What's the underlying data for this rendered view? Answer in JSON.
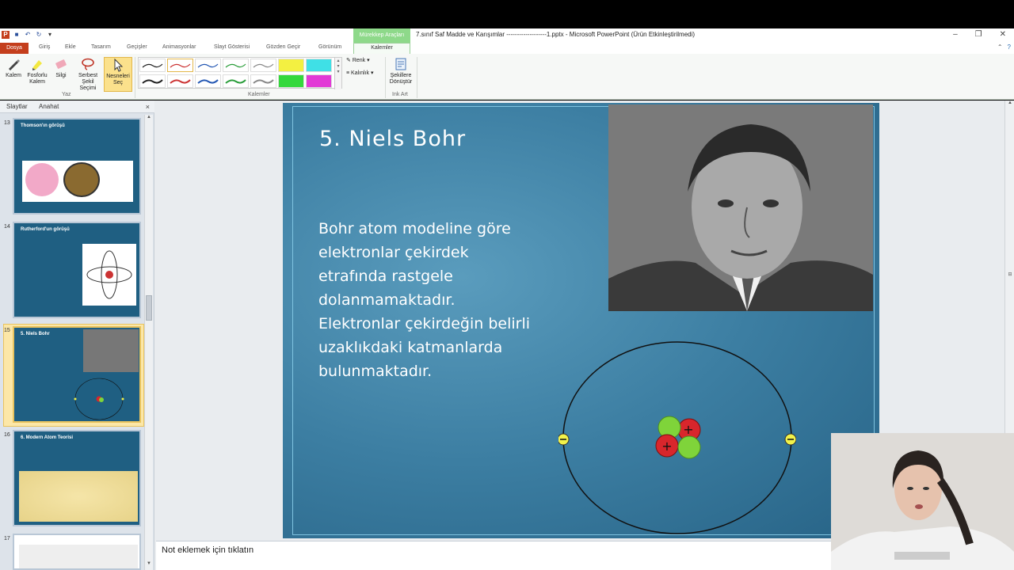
{
  "window": {
    "title": "7.sınıf Saf Madde ve Karışımlar -------------------1.pptx  -  Microsoft PowerPoint (Ürün Etkinleştirilmedi)",
    "context_tab_title": "Mürekkep Araçları"
  },
  "tabs": [
    "Dosya",
    "Giriş",
    "Ekle",
    "Tasarım",
    "Geçişler",
    "Animasyonlar",
    "Slayt Gösterisi",
    "Gözden Geçir",
    "Görünüm",
    "Kalemler"
  ],
  "ribbon": {
    "buttons": [
      {
        "label": "Kalem",
        "icon": "pen-icon"
      },
      {
        "label": "Fosforlu Kalem",
        "icon": "highlighter-icon"
      },
      {
        "label": "Silgi",
        "icon": "eraser-icon"
      },
      {
        "label": "Serbest Şekil Seçimi",
        "icon": "lasso-icon"
      },
      {
        "label": "Nesneleri Seç",
        "icon": "cursor-icon"
      }
    ],
    "group_yaz": "Yaz",
    "group_kalemler": "Kalemler",
    "group_ink_art": "Ink Art",
    "renk": "Renk",
    "kalinlik": "Kalınlık",
    "convert_label": "Şekillere Dönüştür"
  },
  "panel": {
    "tab_slides": "Slaytlar",
    "tab_outline": "Anahat",
    "slide_numbers": [
      "13",
      "14",
      "15",
      "16",
      "17"
    ]
  },
  "slide": {
    "title": "5. Niels Bohr",
    "body_lines": [
      "Bohr atom modeline göre",
      "elektronlar çekirdek",
      "etrafında rastgele",
      "dolanmamaktadır.",
      "Elektronlar çekirdeğin belirli",
      "uzaklıkdaki katmanlarda",
      "bulunmaktadır."
    ]
  },
  "notes_placeholder": "Not eklemek için tıklatın",
  "colors": {
    "file_tab": "#c43e1c",
    "context_tab": "#8ed98a",
    "slide_bg": "#3c7ea2",
    "proton": "#d8262c",
    "neutron": "#7fd43a",
    "electron": "#f2f24a"
  }
}
